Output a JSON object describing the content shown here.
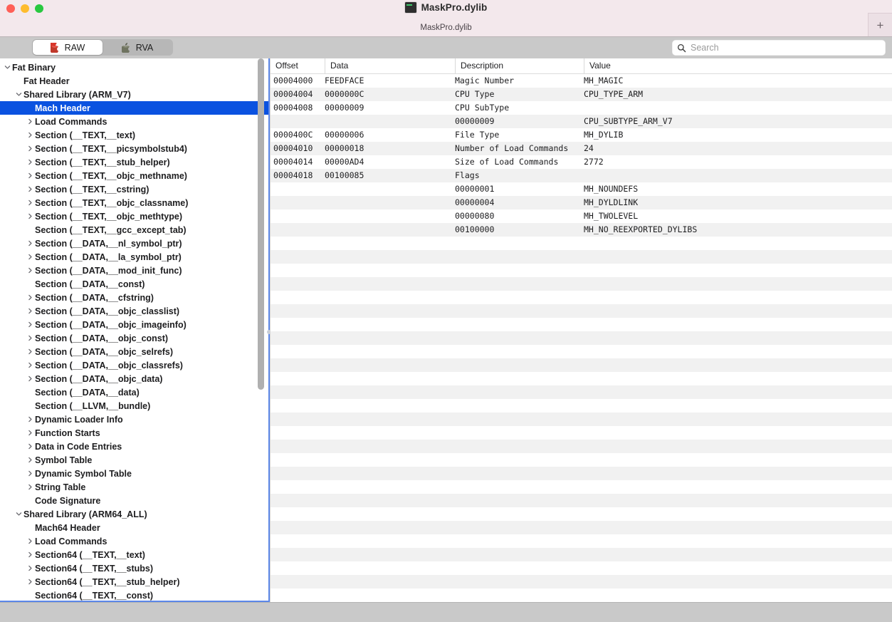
{
  "window": {
    "title": "MaskPro.dylib",
    "subtitle": "MaskPro.dylib",
    "doc_icon": "terminal-document-icon",
    "traffic_lights": [
      "close",
      "minimize",
      "zoom"
    ],
    "new_tab_label": "+"
  },
  "toolbar": {
    "segments": [
      {
        "label": "RAW",
        "selected": true,
        "icon": "red-apple-icon"
      },
      {
        "label": "RVA",
        "selected": false,
        "icon": "gray-apple-icon"
      }
    ],
    "search": {
      "placeholder": "Search",
      "value": "",
      "icon": "search-icon"
    }
  },
  "sidebar": {
    "items": [
      {
        "label": "Fat Binary",
        "indent": 0,
        "twisty": "down"
      },
      {
        "label": "Fat Header",
        "indent": 1,
        "twisty": "none"
      },
      {
        "label": "Shared Library  (ARM_V7)",
        "indent": 1,
        "twisty": "down"
      },
      {
        "label": "Mach Header",
        "indent": 2,
        "twisty": "none",
        "selected": true
      },
      {
        "label": "Load Commands",
        "indent": 2,
        "twisty": "right"
      },
      {
        "label": "Section (__TEXT,__text)",
        "indent": 2,
        "twisty": "right"
      },
      {
        "label": "Section (__TEXT,__picsymbolstub4)",
        "indent": 2,
        "twisty": "right"
      },
      {
        "label": "Section (__TEXT,__stub_helper)",
        "indent": 2,
        "twisty": "right"
      },
      {
        "label": "Section (__TEXT,__objc_methname)",
        "indent": 2,
        "twisty": "right"
      },
      {
        "label": "Section (__TEXT,__cstring)",
        "indent": 2,
        "twisty": "right"
      },
      {
        "label": "Section (__TEXT,__objc_classname)",
        "indent": 2,
        "twisty": "right"
      },
      {
        "label": "Section (__TEXT,__objc_methtype)",
        "indent": 2,
        "twisty": "right"
      },
      {
        "label": "Section (__TEXT,__gcc_except_tab)",
        "indent": 2,
        "twisty": "none"
      },
      {
        "label": "Section (__DATA,__nl_symbol_ptr)",
        "indent": 2,
        "twisty": "right"
      },
      {
        "label": "Section (__DATA,__la_symbol_ptr)",
        "indent": 2,
        "twisty": "right"
      },
      {
        "label": "Section (__DATA,__mod_init_func)",
        "indent": 2,
        "twisty": "right"
      },
      {
        "label": "Section (__DATA,__const)",
        "indent": 2,
        "twisty": "none"
      },
      {
        "label": "Section (__DATA,__cfstring)",
        "indent": 2,
        "twisty": "right"
      },
      {
        "label": "Section (__DATA,__objc_classlist)",
        "indent": 2,
        "twisty": "right"
      },
      {
        "label": "Section (__DATA,__objc_imageinfo)",
        "indent": 2,
        "twisty": "right"
      },
      {
        "label": "Section (__DATA,__objc_const)",
        "indent": 2,
        "twisty": "right"
      },
      {
        "label": "Section (__DATA,__objc_selrefs)",
        "indent": 2,
        "twisty": "right"
      },
      {
        "label": "Section (__DATA,__objc_classrefs)",
        "indent": 2,
        "twisty": "right"
      },
      {
        "label": "Section (__DATA,__objc_data)",
        "indent": 2,
        "twisty": "right"
      },
      {
        "label": "Section (__DATA,__data)",
        "indent": 2,
        "twisty": "none"
      },
      {
        "label": "Section (__LLVM,__bundle)",
        "indent": 2,
        "twisty": "none"
      },
      {
        "label": "Dynamic Loader Info",
        "indent": 2,
        "twisty": "right"
      },
      {
        "label": "Function Starts",
        "indent": 2,
        "twisty": "right"
      },
      {
        "label": "Data in Code Entries",
        "indent": 2,
        "twisty": "right"
      },
      {
        "label": "Symbol Table",
        "indent": 2,
        "twisty": "right"
      },
      {
        "label": "Dynamic Symbol Table",
        "indent": 2,
        "twisty": "right"
      },
      {
        "label": "String Table",
        "indent": 2,
        "twisty": "right"
      },
      {
        "label": "Code Signature",
        "indent": 2,
        "twisty": "none"
      },
      {
        "label": "Shared Library  (ARM64_ALL)",
        "indent": 1,
        "twisty": "down"
      },
      {
        "label": "Mach64 Header",
        "indent": 2,
        "twisty": "none"
      },
      {
        "label": "Load Commands",
        "indent": 2,
        "twisty": "right"
      },
      {
        "label": "Section64 (__TEXT,__text)",
        "indent": 2,
        "twisty": "right"
      },
      {
        "label": "Section64 (__TEXT,__stubs)",
        "indent": 2,
        "twisty": "right"
      },
      {
        "label": "Section64 (__TEXT,__stub_helper)",
        "indent": 2,
        "twisty": "right"
      },
      {
        "label": "Section64 (__TEXT,__const)",
        "indent": 2,
        "twisty": "none"
      }
    ]
  },
  "table": {
    "columns": [
      "Offset",
      "Data",
      "Description",
      "Value"
    ],
    "rows": [
      {
        "offset": "00004000",
        "data": "FEEDFACE",
        "description": "Magic Number",
        "value": "MH_MAGIC"
      },
      {
        "offset": "00004004",
        "data": "0000000C",
        "description": "CPU Type",
        "value": "CPU_TYPE_ARM"
      },
      {
        "offset": "00004008",
        "data": "00000009",
        "description": "CPU SubType",
        "value": ""
      },
      {
        "offset": "",
        "data": "",
        "description": "00000009",
        "value": "CPU_SUBTYPE_ARM_V7"
      },
      {
        "offset": "0000400C",
        "data": "00000006",
        "description": "File Type",
        "value": "MH_DYLIB"
      },
      {
        "offset": "00004010",
        "data": "00000018",
        "description": "Number of Load Commands",
        "value": "24"
      },
      {
        "offset": "00004014",
        "data": "00000AD4",
        "description": "Size of Load Commands",
        "value": "2772"
      },
      {
        "offset": "00004018",
        "data": "00100085",
        "description": "Flags",
        "value": ""
      },
      {
        "offset": "",
        "data": "",
        "description": "00000001",
        "value": "MH_NOUNDEFS"
      },
      {
        "offset": "",
        "data": "",
        "description": "00000004",
        "value": "MH_DYLDLINK"
      },
      {
        "offset": "",
        "data": "",
        "description": "00000080",
        "value": "MH_TWOLEVEL"
      },
      {
        "offset": "",
        "data": "",
        "description": "00100000",
        "value": "MH_NO_REEXPORTED_DYLIBS"
      }
    ],
    "blank_row_count": 28
  }
}
